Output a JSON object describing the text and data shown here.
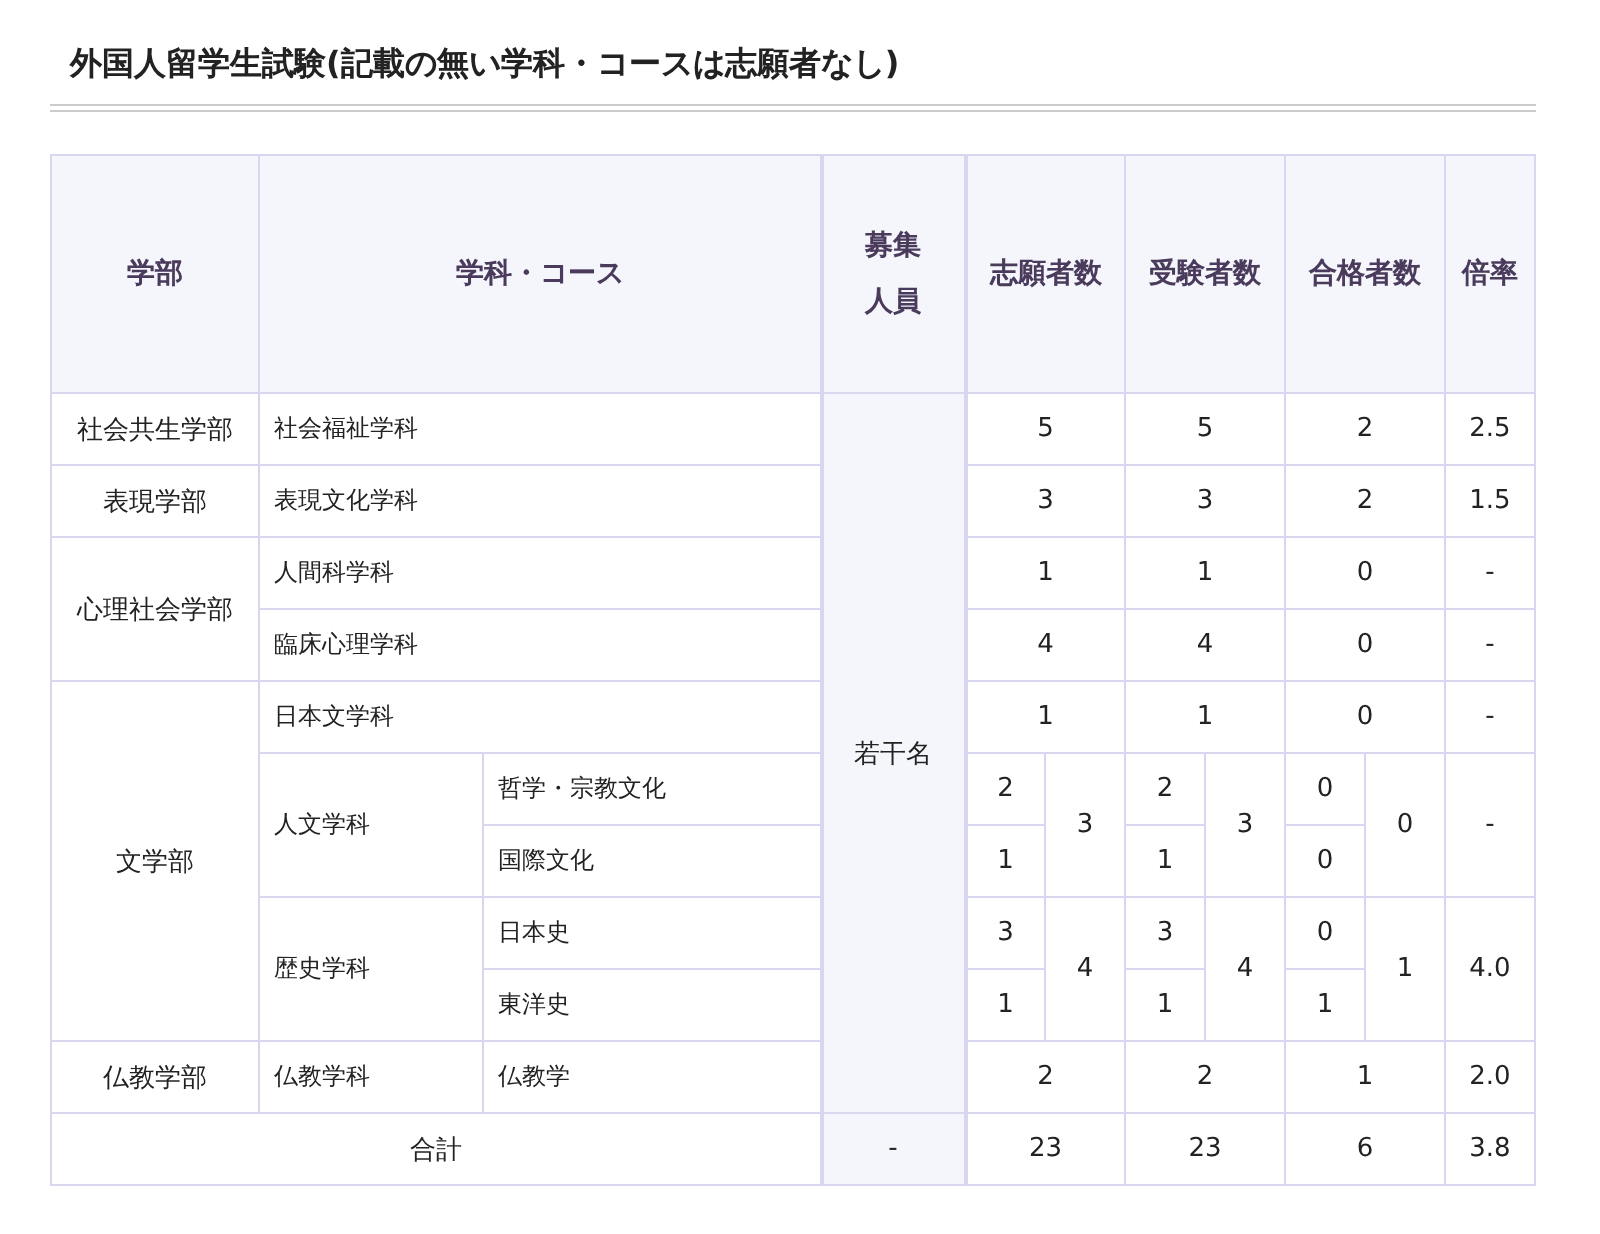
{
  "title": "外国人留学生試験(記載の無い学科・コースは志願者なし)",
  "table": {
    "columns": {
      "faculty": "学部",
      "department": "学科・コース",
      "recruitment": [
        "募集",
        "人員"
      ],
      "applicants": "志願者数",
      "examinees": "受験者数",
      "passed": "合格者数",
      "rate": "倍率"
    },
    "recruitment": "若干名",
    "faculties": [
      {
        "name": "社会共生学部",
        "departments": [
          {
            "name": "社会福祉学科",
            "applicants": "5",
            "examinees": "5",
            "passed": "2",
            "rate": "2.5"
          }
        ]
      },
      {
        "name": "表現学部",
        "departments": [
          {
            "name": "表現文化学科",
            "applicants": "3",
            "examinees": "3",
            "passed": "2",
            "rate": "1.5"
          }
        ]
      },
      {
        "name": "心理社会学部",
        "departments": [
          {
            "name": "人間科学科",
            "applicants": "1",
            "examinees": "1",
            "passed": "0",
            "rate": "-"
          },
          {
            "name": "臨床心理学科",
            "applicants": "4",
            "examinees": "4",
            "passed": "0",
            "rate": "-"
          }
        ]
      },
      {
        "name": "文学部",
        "departments": [
          {
            "name": "日本文学科",
            "applicants": "1",
            "examinees": "1",
            "passed": "0",
            "rate": "-"
          },
          {
            "name": "人文学科",
            "applicants": "3",
            "examinees": "3",
            "passed": "0",
            "rate": "-",
            "courses": [
              {
                "name": "哲学・宗教文化",
                "applicants": "2",
                "examinees": "2",
                "passed": "0"
              },
              {
                "name": "国際文化",
                "applicants": "1",
                "examinees": "1",
                "passed": "0"
              }
            ]
          },
          {
            "name": "歴史学科",
            "applicants": "4",
            "examinees": "4",
            "passed": "1",
            "rate": "4.0",
            "courses": [
              {
                "name": "日本史",
                "applicants": "3",
                "examinees": "3",
                "passed": "0"
              },
              {
                "name": "東洋史",
                "applicants": "1",
                "examinees": "1",
                "passed": "1"
              }
            ]
          }
        ]
      },
      {
        "name": "仏教学部",
        "departments": [
          {
            "name": "仏教学科",
            "applicants": "2",
            "examinees": "2",
            "passed": "1",
            "rate": "2.0",
            "courses": [
              {
                "name": "仏教学"
              }
            ]
          }
        ]
      }
    ],
    "total": {
      "label": "合計",
      "recruitment": "-",
      "applicants": "23",
      "examinees": "23",
      "passed": "6",
      "rate": "3.8"
    }
  }
}
